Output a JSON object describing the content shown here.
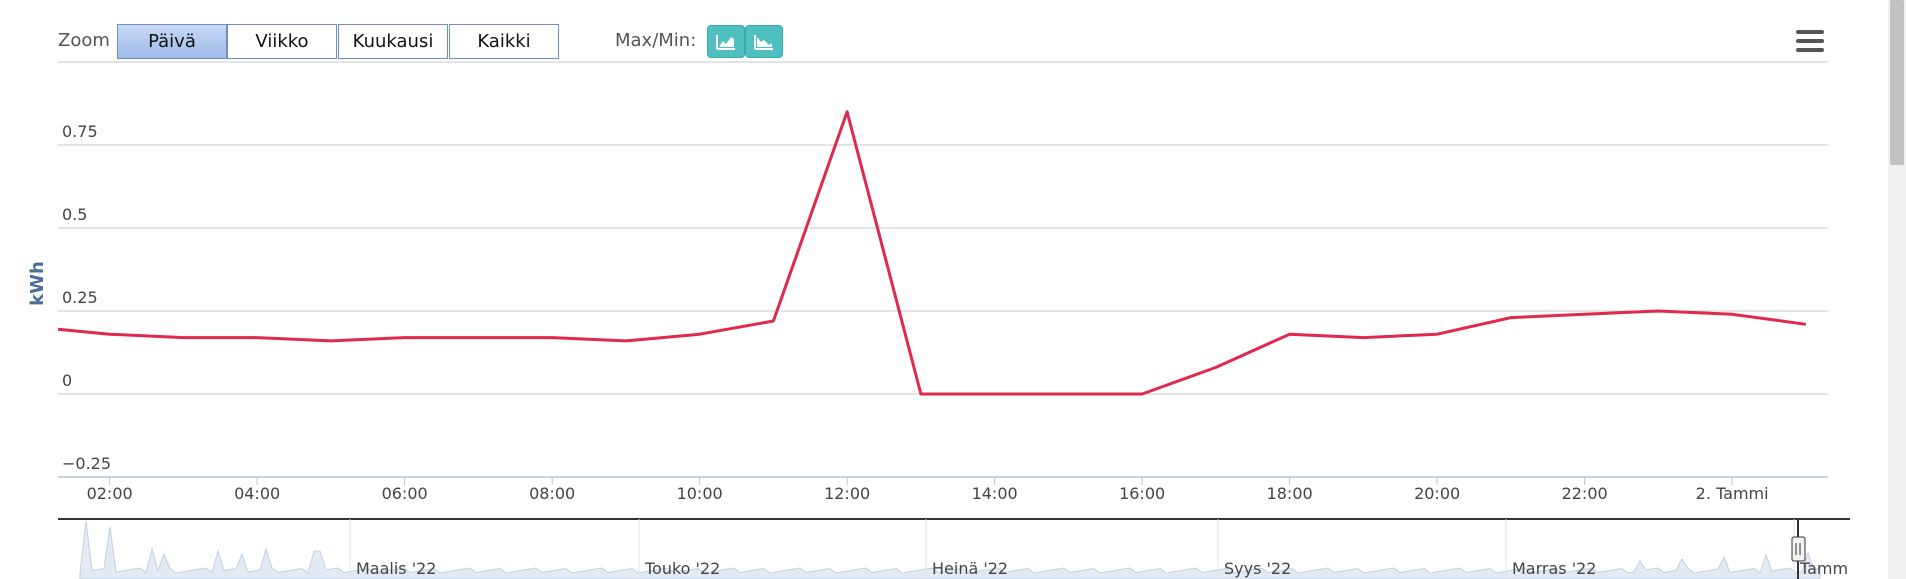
{
  "toolbar": {
    "zoom_label": "Zoom",
    "zoom_buttons": [
      {
        "label": "Päivä",
        "active": true
      },
      {
        "label": "Viikko",
        "active": false
      },
      {
        "label": "Kuukausi",
        "active": false
      },
      {
        "label": "Kaikki",
        "active": false
      }
    ],
    "maxmin_label": "Max/Min:",
    "icons": [
      "chart-max-icon",
      "chart-min-icon",
      "menu-icon"
    ]
  },
  "colors": {
    "series": "#e0294f",
    "grid": "#c8c8c8",
    "axis_title": "#4a6d9a",
    "button_active": "#aec6ee",
    "icon_button": "#4fbfc0",
    "navigator_fill": "#e3eaf3"
  },
  "chart_data": {
    "type": "line",
    "ylabel": "kWh",
    "ylim": [
      -0.25,
      1.0
    ],
    "y_ticks": [
      -0.25,
      0,
      0.25,
      0.5,
      0.75
    ],
    "y_tick_labels": [
      "−0.25",
      "0",
      "0.25",
      "0.5",
      "0.75"
    ],
    "x_range": [
      1.3,
      25.3
    ],
    "x_ticks": [
      2,
      4,
      6,
      8,
      10,
      12,
      14,
      16,
      18,
      20,
      22,
      24
    ],
    "x_tick_labels": [
      "02:00",
      "04:00",
      "06:00",
      "08:00",
      "10:00",
      "12:00",
      "14:00",
      "16:00",
      "18:00",
      "20:00",
      "22:00",
      "2. Tammi"
    ],
    "series": [
      {
        "x": [
          1.3,
          2,
          3,
          4,
          5,
          6,
          7,
          8,
          9,
          10,
          11,
          12,
          13,
          14,
          15,
          16,
          17,
          18,
          19,
          20,
          21,
          22,
          23,
          24,
          25
        ],
        "values": [
          0.195,
          0.18,
          0.17,
          0.17,
          0.16,
          0.17,
          0.17,
          0.17,
          0.16,
          0.18,
          0.22,
          0.85,
          0.0,
          0.0,
          0.0,
          0.0,
          0.08,
          0.18,
          0.17,
          0.18,
          0.23,
          0.24,
          0.25,
          0.24,
          0.21
        ]
      }
    ],
    "navigator": {
      "labels": [
        "Maalis '22",
        "Touko '22",
        "Heinä '22",
        "Syys '22",
        "Marras '22",
        "Tamm"
      ]
    }
  }
}
